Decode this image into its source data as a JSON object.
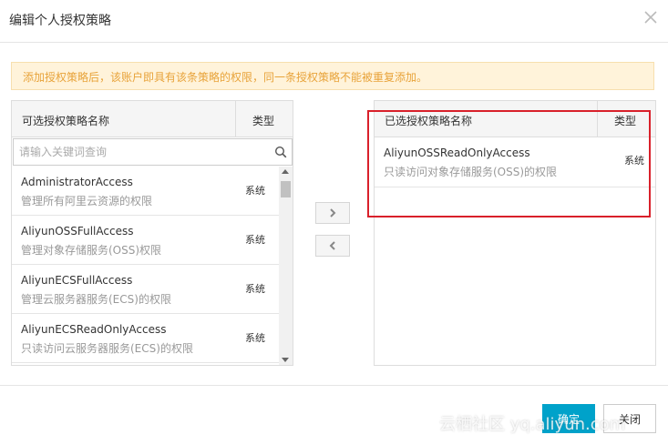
{
  "dialog": {
    "title": "编辑个人授权策略"
  },
  "notice": {
    "text": "添加授权策略后，该账户即具有该条策略的权限，同一条授权策略不能被重复添加。",
    "color": "#e8a33a"
  },
  "available": {
    "header_name": "可选授权策略名称",
    "header_type": "类型",
    "search_placeholder": "请输入关键词查询",
    "items": [
      {
        "name": "AdministratorAccess",
        "desc": "管理所有阿里云资源的权限",
        "type": "系统"
      },
      {
        "name": "AliyunOSSFullAccess",
        "desc": "管理对象存储服务(OSS)权限",
        "type": "系统"
      },
      {
        "name": "AliyunECSFullAccess",
        "desc": "管理云服务器服务(ECS)的权限",
        "type": "系统"
      },
      {
        "name": "AliyunECSReadOnlyAccess",
        "desc": "只读访问云服务器服务(ECS)的权限",
        "type": "系统"
      }
    ]
  },
  "selected": {
    "header_name": "已选授权策略名称",
    "header_type": "类型",
    "items": [
      {
        "name": "AliyunOSSReadOnlyAccess",
        "desc": "只读访问对象存储服务(OSS)的权限",
        "type": "系统"
      }
    ]
  },
  "transfer": {
    "right_icon": "chevron-right-icon",
    "left_icon": "chevron-left-icon"
  },
  "footer": {
    "confirm_label": "确定",
    "close_label": "关闭",
    "primary_color": "#00a2ca"
  },
  "highlight_color": "#d9202a",
  "watermark": "云栖社区 yq.aliyun.com"
}
